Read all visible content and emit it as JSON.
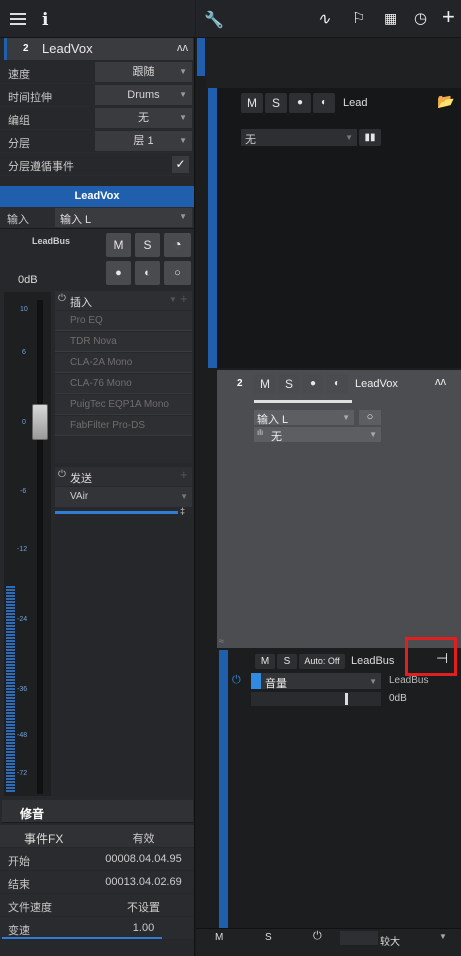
{
  "top_toolbar": {
    "menu_icon": "hamburger-icon",
    "info_icon": "info-icon"
  },
  "right_toolbar": {
    "wrench_icon": "wrench-icon",
    "automation_icon": "automation-curve-icon",
    "marker_icon": "flag-icon",
    "grid_icon": "grid-icon",
    "tempo_icon": "metronome-icon",
    "add_icon": "plus-icon"
  },
  "track_inspector": {
    "track_number": "2",
    "track_name": "LeadVox",
    "params": [
      {
        "label": "速度",
        "value": "跟随"
      },
      {
        "label": "时间拉伸",
        "value": "Drums"
      },
      {
        "label": "编组",
        "value": "无"
      },
      {
        "label": "分层",
        "value": "层 1"
      }
    ],
    "layer_follow_label": "分层遵循事件",
    "layer_follow_checked": true
  },
  "channel_strip": {
    "title": "LeadVox",
    "input_label": "输入",
    "input_value": "输入 L",
    "bus_name": "LeadBus",
    "mute": "M",
    "solo": "S",
    "volume": "0dB",
    "inserts_label": "插入",
    "inserts": [
      "Pro EQ",
      "TDR Nova",
      "CLA-2A Mono",
      "CLA-76 Mono",
      "PuigTec EQP1A Mono",
      "FabFilter Pro-DS"
    ],
    "sends_label": "发送",
    "sends": [
      "VAir"
    ],
    "scale": [
      "10",
      "6",
      "0",
      "-6",
      "-12",
      "-24",
      "-36",
      "-48",
      "-72"
    ]
  },
  "event_inspector": {
    "title": "修音",
    "event_fx_label": "事件FX",
    "event_fx_value": "有效",
    "rows": [
      {
        "label": "开始",
        "value": "00008.04.04.95"
      },
      {
        "label": "结束",
        "value": "00013.04.02.69"
      },
      {
        "label": "文件速度",
        "value": "不设置"
      },
      {
        "label": "变速",
        "value": "1.00"
      }
    ]
  },
  "track_lead": {
    "mute": "M",
    "solo": "S",
    "name": "Lead",
    "dropdown_value": "无"
  },
  "track_leadvox": {
    "number": "2",
    "mute": "M",
    "solo": "S",
    "name": "LeadVox",
    "input_value": "输入 L",
    "layer_value": "无"
  },
  "track_leadbus": {
    "mute": "M",
    "solo": "S",
    "auto_label": "Auto: Off",
    "name": "LeadBus",
    "param_label": "音量",
    "param_bus": "LeadBus",
    "param_value": "0dB"
  },
  "bottom_bar": {
    "m": "M",
    "s": "S",
    "zoom_label": "较大"
  },
  "colors": {
    "accent": "#1f5fae",
    "highlight_box": "#e02020"
  }
}
